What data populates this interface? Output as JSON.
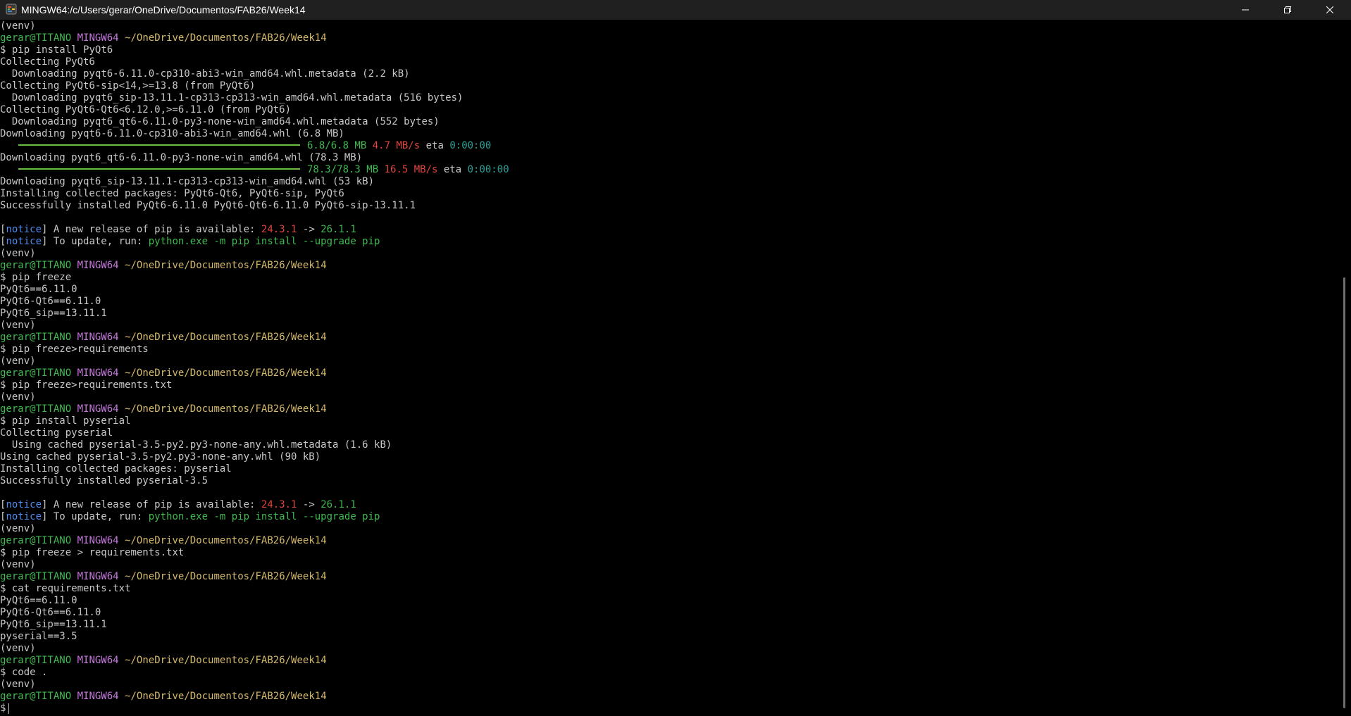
{
  "window": {
    "title": "MINGW64:/c/Users/gerar/OneDrive/Documentos/FAB26/Week14",
    "icon": "git-bash-icon"
  },
  "controls": {
    "minimize": "minimize-icon",
    "maximize": "restore-icon",
    "close": "close-icon"
  },
  "prompt": {
    "user": "gerar@TITANO",
    "shell": "MINGW64",
    "path": "~/OneDrive/Documentos/FAB26/Week14",
    "dollar": "$"
  },
  "colors": {
    "green": "#3fb950",
    "magenta": "#c678dd",
    "yellow": "#d4b86a",
    "red": "#e0443e",
    "blue": "#4f8cf0",
    "text": "#c8c8c8",
    "cyan": "#2aa198",
    "background": "#000000"
  },
  "lines": [
    {
      "t": "out",
      "text": "(venv)"
    },
    {
      "t": "prompt"
    },
    {
      "t": "cmd",
      "text": "pip install PyQt6"
    },
    {
      "t": "out",
      "text": "Collecting PyQt6"
    },
    {
      "t": "out",
      "text": "  Downloading pyqt6-6.11.0-cp310-abi3-win_amd64.whl.metadata (2.2 kB)"
    },
    {
      "t": "out",
      "text": "Collecting PyQt6-sip<14,>=13.8 (from PyQt6)"
    },
    {
      "t": "out",
      "text": "  Downloading pyqt6_sip-13.11.1-cp313-cp313-win_amd64.whl.metadata (516 bytes)"
    },
    {
      "t": "out",
      "text": "Collecting PyQt6-Qt6<6.12.0,>=6.11.0 (from PyQt6)"
    },
    {
      "t": "out",
      "text": "  Downloading pyqt6_qt6-6.11.0-py3-none-win_amd64.whl.metadata (552 bytes)"
    },
    {
      "t": "out",
      "text": "Downloading pyqt6-6.11.0-cp310-abi3-win_amd64.whl (6.8 MB)"
    },
    {
      "t": "progress",
      "progress": 1.0,
      "size": "6.8/6.8 MB",
      "speed": "4.7 MB/s",
      "eta_label": "eta",
      "eta": "0:00:00"
    },
    {
      "t": "out",
      "text": "Downloading pyqt6_qt6-6.11.0-py3-none-win_amd64.whl (78.3 MB)"
    },
    {
      "t": "progress",
      "progress": 1.0,
      "size": "78.3/78.3 MB",
      "speed": "16.5 MB/s",
      "eta_label": "eta",
      "eta": "0:00:00"
    },
    {
      "t": "out",
      "text": "Downloading pyqt6_sip-13.11.1-cp313-cp313-win_amd64.whl (53 kB)"
    },
    {
      "t": "out",
      "text": "Installing collected packages: PyQt6-Qt6, PyQt6-sip, PyQt6"
    },
    {
      "t": "out",
      "text": "Successfully installed PyQt6-6.11.0 PyQt6-Qt6-6.11.0 PyQt6-sip-13.11.1"
    },
    {
      "t": "blank"
    },
    {
      "t": "notice1",
      "label": "notice",
      "text": " A new release of pip is available: ",
      "old": "24.3.1",
      "arrow": " -> ",
      "new": "26.1.1"
    },
    {
      "t": "notice2",
      "label": "notice",
      "text": " To update, run: ",
      "cmd": "python.exe -m pip install --upgrade pip"
    },
    {
      "t": "out",
      "text": "(venv)"
    },
    {
      "t": "prompt"
    },
    {
      "t": "cmd",
      "text": "pip freeze"
    },
    {
      "t": "out",
      "text": "PyQt6==6.11.0"
    },
    {
      "t": "out",
      "text": "PyQt6-Qt6==6.11.0"
    },
    {
      "t": "out",
      "text": "PyQt6_sip==13.11.1"
    },
    {
      "t": "out",
      "text": "(venv)"
    },
    {
      "t": "prompt"
    },
    {
      "t": "cmd",
      "text": "pip freeze>requirements"
    },
    {
      "t": "out",
      "text": "(venv)"
    },
    {
      "t": "prompt"
    },
    {
      "t": "cmd",
      "text": "pip freeze>requirements.txt"
    },
    {
      "t": "out",
      "text": "(venv)"
    },
    {
      "t": "prompt"
    },
    {
      "t": "cmd",
      "text": "pip install pyserial"
    },
    {
      "t": "out",
      "text": "Collecting pyserial"
    },
    {
      "t": "out",
      "text": "  Using cached pyserial-3.5-py2.py3-none-any.whl.metadata (1.6 kB)"
    },
    {
      "t": "out",
      "text": "Using cached pyserial-3.5-py2.py3-none-any.whl (90 kB)"
    },
    {
      "t": "out",
      "text": "Installing collected packages: pyserial"
    },
    {
      "t": "out",
      "text": "Successfully installed pyserial-3.5"
    },
    {
      "t": "blank"
    },
    {
      "t": "notice1",
      "label": "notice",
      "text": " A new release of pip is available: ",
      "old": "24.3.1",
      "arrow": " -> ",
      "new": "26.1.1"
    },
    {
      "t": "notice2",
      "label": "notice",
      "text": " To update, run: ",
      "cmd": "python.exe -m pip install --upgrade pip"
    },
    {
      "t": "out",
      "text": "(venv)"
    },
    {
      "t": "prompt"
    },
    {
      "t": "cmd",
      "text": "pip freeze > requirements.txt"
    },
    {
      "t": "out",
      "text": "(venv)"
    },
    {
      "t": "prompt"
    },
    {
      "t": "cmd",
      "text": "cat requirements.txt"
    },
    {
      "t": "out",
      "text": "PyQt6==6.11.0"
    },
    {
      "t": "out",
      "text": "PyQt6-Qt6==6.11.0"
    },
    {
      "t": "out",
      "text": "PyQt6_sip==13.11.1"
    },
    {
      "t": "out",
      "text": "pyserial==3.5"
    },
    {
      "t": "out",
      "text": "(venv)"
    },
    {
      "t": "prompt"
    },
    {
      "t": "cmd",
      "text": "code ."
    },
    {
      "t": "out",
      "text": "(venv)"
    },
    {
      "t": "prompt"
    },
    {
      "t": "cursor"
    }
  ]
}
